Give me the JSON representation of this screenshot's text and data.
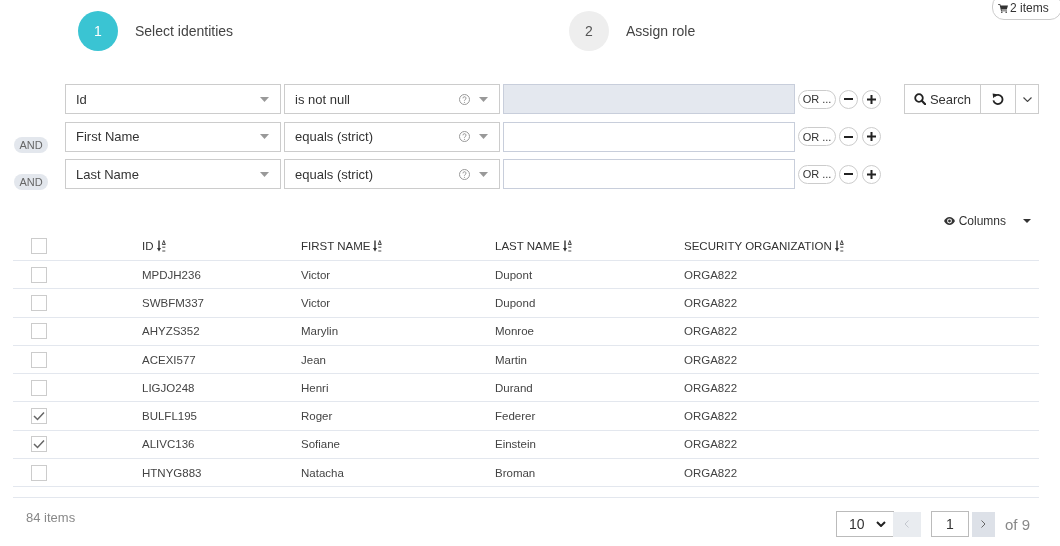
{
  "cart": {
    "label": "2 items"
  },
  "steps": [
    {
      "number": "1",
      "label": "Select identities",
      "selected": true
    },
    {
      "number": "2",
      "label": "Assign role",
      "selected": false
    }
  ],
  "filters": [
    {
      "field": "Id",
      "operator": "is not null",
      "value_disabled": true,
      "or_label": "OR ..."
    },
    {
      "connector": "AND",
      "field": "First Name",
      "operator": "equals (strict)",
      "value_disabled": false,
      "or_label": "OR ..."
    },
    {
      "connector": "AND",
      "field": "Last Name",
      "operator": "equals (strict)",
      "value_disabled": false,
      "or_label": "OR ..."
    }
  ],
  "search_button": {
    "label": "Search"
  },
  "columns_button": {
    "label": "Columns"
  },
  "table": {
    "all_selected": false,
    "columns": [
      "ID",
      "FIRST NAME",
      "LAST NAME",
      "SECURITY ORGANIZATION"
    ],
    "rows": [
      {
        "cells": [
          "MPDJH236",
          "Victor",
          "Dupont",
          "ORGA822"
        ],
        "selected": false
      },
      {
        "cells": [
          "SWBFM337",
          "Victor",
          "Dupond",
          "ORGA822"
        ],
        "selected": false
      },
      {
        "cells": [
          "AHYZS352",
          "Marylin",
          "Monroe",
          "ORGA822"
        ],
        "selected": false
      },
      {
        "cells": [
          "ACEXI577",
          "Jean",
          "Martin",
          "ORGA822"
        ],
        "selected": false
      },
      {
        "cells": [
          "LIGJO248",
          "Henri",
          "Durand",
          "ORGA822"
        ],
        "selected": false
      },
      {
        "cells": [
          "BULFL195",
          "Roger",
          "Federer",
          "ORGA822"
        ],
        "selected": true
      },
      {
        "cells": [
          "ALIVC136",
          "Sofiane",
          "Einstein",
          "ORGA822"
        ],
        "selected": true
      },
      {
        "cells": [
          "HTNYG883",
          "Natacha",
          "Broman",
          "ORGA822"
        ],
        "selected": false
      }
    ]
  },
  "footer": {
    "count": "84 items",
    "page_size": "10",
    "page": "1",
    "page_total": "of 9",
    "prev_disabled": true,
    "next_disabled": false
  }
}
